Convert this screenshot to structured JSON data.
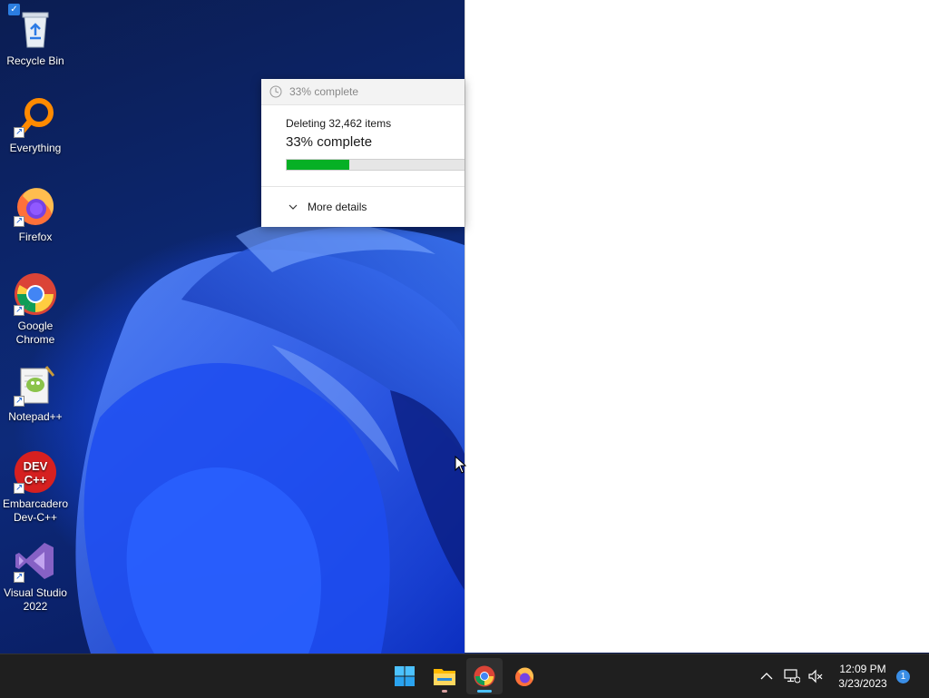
{
  "desktop": {
    "icons": [
      {
        "label": "Recycle Bin",
        "icon": "recycle-bin-icon"
      },
      {
        "label": "Everything",
        "icon": "everything-search-icon"
      },
      {
        "label": "Firefox",
        "icon": "firefox-icon"
      },
      {
        "label": "Google Chrome",
        "icon": "chrome-icon"
      },
      {
        "label": "Notepad++",
        "icon": "notepad-plus-plus-icon"
      },
      {
        "label": "Embarcadero Dev-C++",
        "icon": "dev-cpp-icon"
      },
      {
        "label": "Visual Studio 2022",
        "icon": "visual-studio-icon"
      }
    ]
  },
  "progress_dialog": {
    "title": "33% complete",
    "status": "Deleting 32,462 items",
    "percent_text": "33% complete",
    "progress_value": 0.33,
    "progress_color": "#06b025",
    "more_details": "More details"
  },
  "taskbar": {
    "apps": [
      {
        "name": "start",
        "icon": "windows-start-icon"
      },
      {
        "name": "file-explorer",
        "icon": "folder-icon"
      },
      {
        "name": "chrome",
        "icon": "chrome-icon",
        "active": true
      },
      {
        "name": "firefox",
        "icon": "firefox-icon"
      }
    ],
    "tray": {
      "time": "12:09 PM",
      "date": "3/23/2023",
      "notification_count": "1"
    }
  },
  "colors": {
    "taskbar_bg": "#1f1f1f",
    "accent_blue": "#3a8ee6",
    "progress_green": "#06b025"
  }
}
